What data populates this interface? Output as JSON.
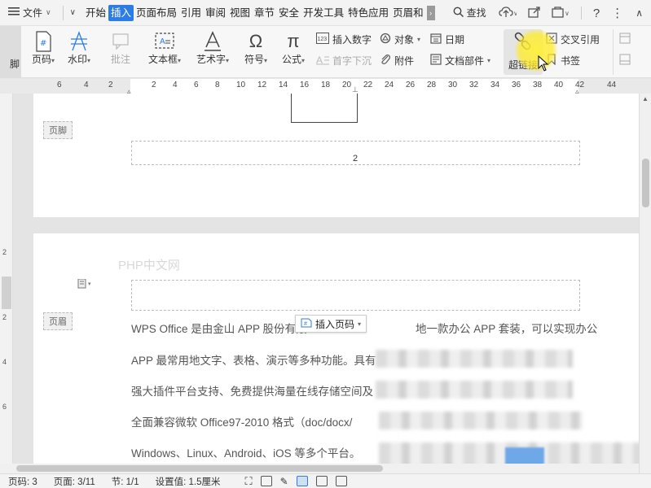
{
  "menubar": {
    "file_label": "文件",
    "tabs": [
      {
        "label": "开始"
      },
      {
        "label": "插入",
        "active": true
      },
      {
        "label": "页面布局"
      },
      {
        "label": "引用"
      },
      {
        "label": "审阅"
      },
      {
        "label": "视图"
      },
      {
        "label": "章节"
      },
      {
        "label": "安全"
      },
      {
        "label": "开发工具"
      },
      {
        "label": "特色应用"
      },
      {
        "label": "页眉和"
      }
    ],
    "search_label": "查找",
    "accent_color": "#2d7be5"
  },
  "ribbon": {
    "left_partial": "脚",
    "page_number": "页码",
    "watermark": "水印",
    "comment": "批注",
    "textbox": "文本框",
    "wordart": "艺术字",
    "symbol": "符号",
    "formula": "公式",
    "insert_number": "插入数字",
    "dropcap": "首字下沉",
    "object": "对象",
    "attachment": "附件",
    "date": "日期",
    "doc_parts": "文档部件",
    "hyperlink": "超链接",
    "cross_ref": "交叉引用",
    "bookmark": "书签"
  },
  "ruler": {
    "ticks": [
      "6",
      "4",
      "2",
      "2",
      "4",
      "6",
      "8",
      "10",
      "12",
      "14",
      "16",
      "18",
      "20",
      "22",
      "24",
      "26",
      "28",
      "30",
      "32",
      "34",
      "36",
      "38",
      "40",
      "42",
      "44"
    ]
  },
  "document": {
    "footer_tag": "页脚",
    "header_tag": "页眉",
    "page_number_value": "2",
    "watermark_text": "PHP中文网",
    "insert_page_number_btn": "插入页码",
    "lines": [
      "WPS Office 是由金山 APP 股份有限",
      "APP 最常用地文字、表格、演示等多种功能。具有",
      "强大插件平台支持、免费提供海量在线存储空间及",
      "全面兼容微软 Office97-2010 格式（doc/docx/",
      "Windows、Linux、Android、iOS 等多个平台。"
    ],
    "line1_tail": "地一款办公 APP 套装，可以实现办公"
  },
  "statusbar": {
    "page_code": "页码: 3",
    "page": "页面: 3/11",
    "section": "节: 1/1",
    "setting": "设置值: 1.5厘米"
  }
}
